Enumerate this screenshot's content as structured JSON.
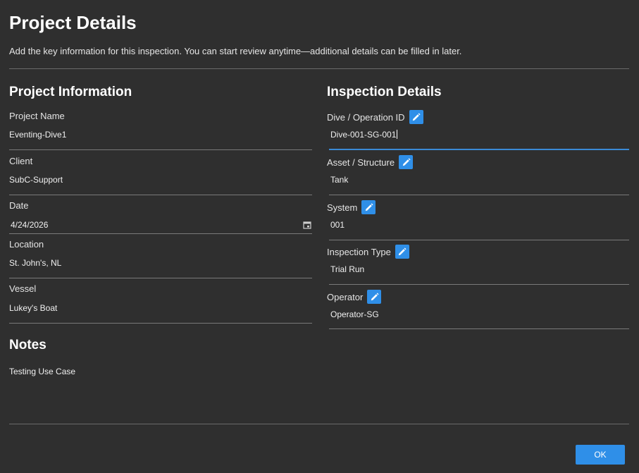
{
  "dialog": {
    "title": "Project Details",
    "subtitle": "Add the key information for this inspection. You can start review anytime—additional details can be filled in later."
  },
  "project_info": {
    "heading": "Project Information",
    "fields": [
      {
        "label": "Project Name",
        "value": "Eventing-Dive1"
      },
      {
        "label": "Client",
        "value": "SubC-Support"
      },
      {
        "label": "Date",
        "value": "4/24/2026"
      },
      {
        "label": "Location",
        "value": "St. John's, NL"
      },
      {
        "label": "Vessel",
        "value": "Lukey's Boat"
      }
    ]
  },
  "notes": {
    "heading": "Notes",
    "value": "Testing Use Case"
  },
  "inspection": {
    "heading": "Inspection Details",
    "fields": [
      {
        "label": "Dive / Operation ID",
        "value": "Dive-001-SG-001",
        "icon": "pencil-icon"
      },
      {
        "label": "Asset / Structure",
        "value": "Tank",
        "icon": "pencil-icon"
      },
      {
        "label": "System",
        "value": "001",
        "icon": "pencil-icon"
      },
      {
        "label": "Inspection Type",
        "value": "Trial Run",
        "icon": "pencil-icon"
      },
      {
        "label": "Operator",
        "value": "Operator-SG",
        "icon": "pencil-icon"
      }
    ]
  },
  "footer": {
    "ok_label": "OK"
  },
  "colors": {
    "background": "#2f2f2f",
    "accent": "#2f8fe8",
    "focus_underline": "#3a8ad6"
  }
}
